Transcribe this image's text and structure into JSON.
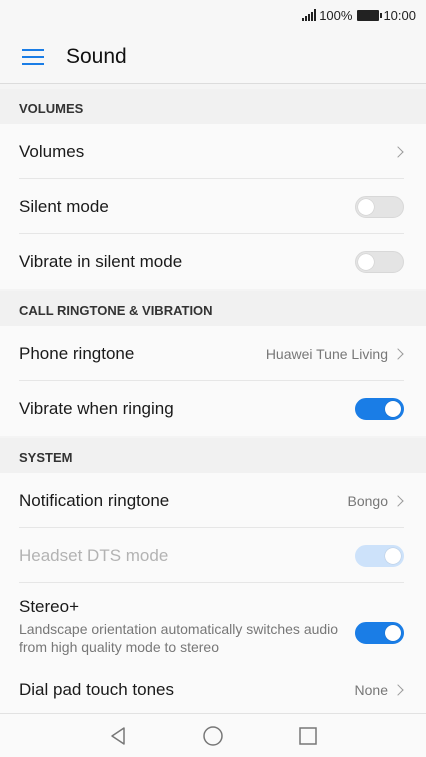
{
  "status": {
    "battery": "100%",
    "time": "10:00"
  },
  "header": {
    "title": "Sound"
  },
  "sections": {
    "volumes": "VOLUMES",
    "call": "CALL RINGTONE & VIBRATION",
    "system": "SYSTEM"
  },
  "rows": {
    "volumes": "Volumes",
    "silent_mode": "Silent mode",
    "vibrate_silent": "Vibrate in silent mode",
    "phone_ringtone": "Phone ringtone",
    "phone_ringtone_value": "Huawei Tune Living",
    "vibrate_ringing": "Vibrate when ringing",
    "notification_ringtone": "Notification ringtone",
    "notification_ringtone_value": "Bongo",
    "headset_dts": "Headset DTS mode",
    "stereo": "Stereo+",
    "stereo_desc": "Landscape orientation automatically switches audio from high quality mode to stereo",
    "dial_pad": "Dial pad touch tones",
    "dial_pad_value": "None"
  },
  "toggles": {
    "silent_mode": false,
    "vibrate_silent": false,
    "vibrate_ringing": true,
    "headset_dts": true,
    "stereo": true
  },
  "colors": {
    "accent": "#1a7de6"
  },
  "icons": [
    "menu-icon",
    "signal-icon",
    "battery-icon",
    "chevron-right-icon",
    "back-icon",
    "home-icon",
    "recents-icon"
  ]
}
